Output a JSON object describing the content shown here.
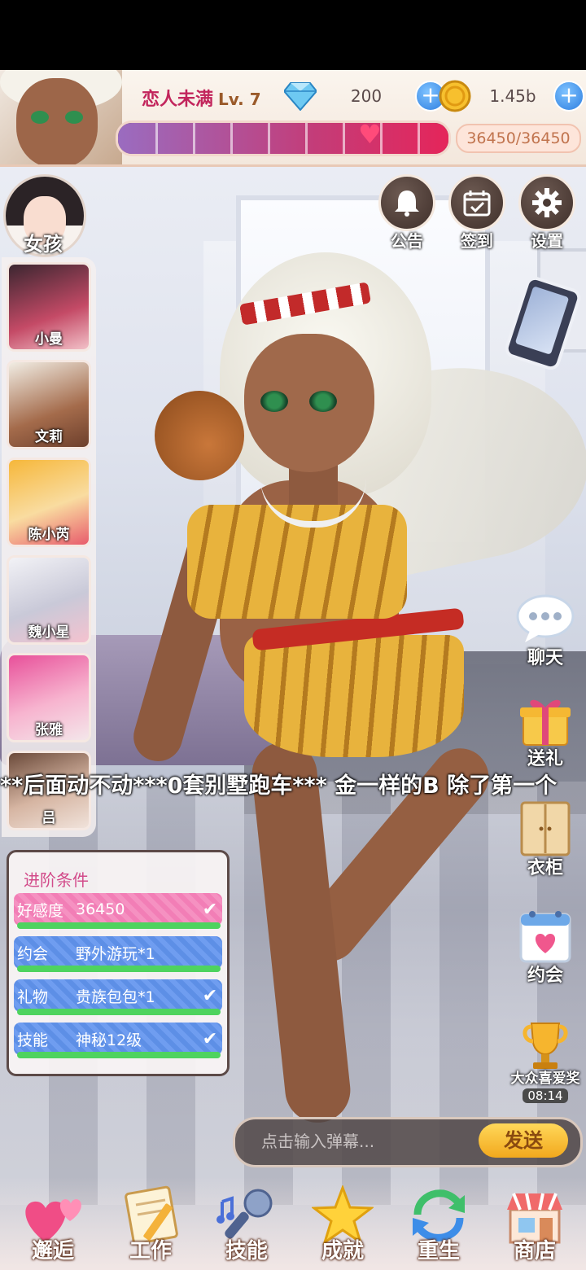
{
  "header": {
    "relationship_title": "恋人未满",
    "level": "Lv. 7",
    "gems": "200",
    "coins": "1.45b",
    "affection_progress_text": "36450/36450",
    "affection_progress_fraction": 1.0
  },
  "top_buttons": [
    {
      "label": "公告",
      "icon": "bell-icon"
    },
    {
      "label": "签到",
      "icon": "calendar-check-icon"
    },
    {
      "label": "设置",
      "icon": "gear-icon"
    }
  ],
  "girls": {
    "header_label": "女孩",
    "list": [
      {
        "name": "小曼"
      },
      {
        "name": "文莉"
      },
      {
        "name": "陈小芮"
      },
      {
        "name": "魏小星"
      },
      {
        "name": "张雅"
      },
      {
        "name": "吕"
      }
    ]
  },
  "marquee": {
    "text": "**后面动不动***0套别墅跑车*** 金一样的B   除了第一个"
  },
  "advancement": {
    "title": "进阶条件",
    "conditions": [
      {
        "key": "好感度",
        "value": "36450",
        "done": true,
        "style": "pink"
      },
      {
        "key": "约会",
        "value": "野外游玩*1",
        "done": false,
        "style": "blue"
      },
      {
        "key": "礼物",
        "value": "贵族包包*1",
        "done": true,
        "style": "blue"
      },
      {
        "key": "技能",
        "value": "神秘12级",
        "done": true,
        "style": "blue"
      }
    ]
  },
  "side_actions": [
    {
      "label": "聊天",
      "icon": "chat-bubble-icon"
    },
    {
      "label": "送礼",
      "icon": "gift-icon"
    },
    {
      "label": "衣柜",
      "icon": "wardrobe-icon"
    },
    {
      "label": "约会",
      "icon": "date-calendar-icon"
    },
    {
      "label": "大众喜爱奖",
      "icon": "trophy-icon",
      "timer": "08:14"
    }
  ],
  "danmaku": {
    "placeholder": "点击输入弹幕...",
    "send_label": "发送"
  },
  "bottom_nav": [
    {
      "label": "邂逅",
      "icon": "hearts-icon"
    },
    {
      "label": "工作",
      "icon": "notebook-pencil-icon"
    },
    {
      "label": "技能",
      "icon": "microphone-icon"
    },
    {
      "label": "成就",
      "icon": "star-icon"
    },
    {
      "label": "重生",
      "icon": "refresh-icon"
    },
    {
      "label": "商店",
      "icon": "shop-icon"
    }
  ],
  "colors": {
    "accent_pink": "#c2255c",
    "progress_end": "#e5255a",
    "send_button": "#f2a81d",
    "check_green": "#4ed35f"
  }
}
